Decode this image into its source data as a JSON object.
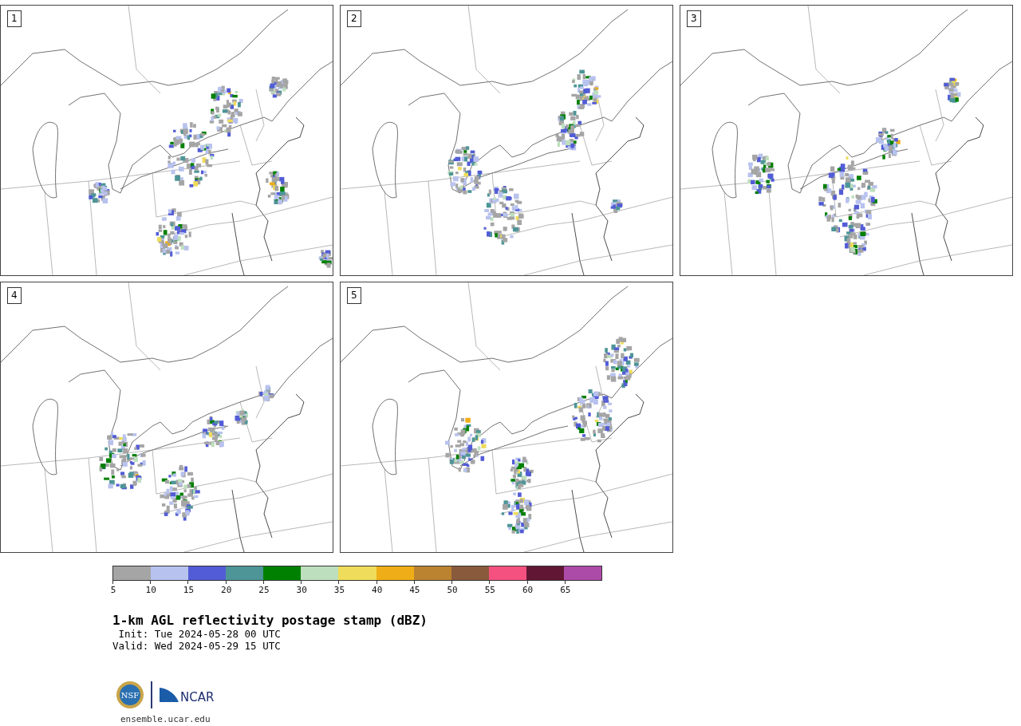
{
  "panels": [
    {
      "label": "1"
    },
    {
      "label": "2"
    },
    {
      "label": "3"
    },
    {
      "label": "4"
    },
    {
      "label": "5"
    }
  ],
  "colorbar": {
    "segments": [
      {
        "color": "#a5a5a5"
      },
      {
        "color": "#b8c2ee"
      },
      {
        "color": "#525cd6"
      },
      {
        "color": "#4e9597"
      },
      {
        "color": "#008000"
      },
      {
        "color": "#bedfbe"
      },
      {
        "color": "#efdc5a"
      },
      {
        "color": "#efae17"
      },
      {
        "color": "#bb832f"
      },
      {
        "color": "#8a5a3d"
      },
      {
        "color": "#f55180"
      },
      {
        "color": "#611734"
      },
      {
        "color": "#ad4ba8"
      }
    ],
    "ticks": [
      "5",
      "10",
      "15",
      "20",
      "25",
      "30",
      "35",
      "40",
      "45",
      "50",
      "55",
      "60",
      "65"
    ]
  },
  "title": "1-km AGL reflectivity postage stamp (dBZ)",
  "init": " Init: Tue 2024-05-28 00 UTC",
  "valid": "Valid: Wed 2024-05-29 15 UTC",
  "logo": {
    "emblem_text": "NSF",
    "wordmark": "NCAR"
  },
  "url": "ensemble.ucar.edu"
}
